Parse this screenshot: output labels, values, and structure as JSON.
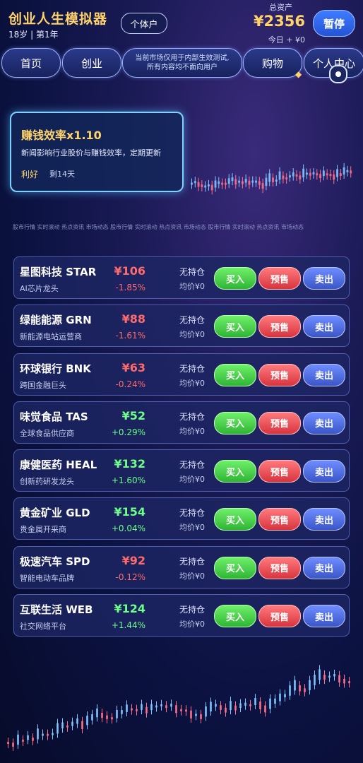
{
  "header": {
    "title": "创业人生模拟器",
    "info": "18岁 | 第1年",
    "role_button": "个体户",
    "assets_label": "总资产",
    "assets_value": "¥2356",
    "today_change": "今日 + ¥0",
    "pause_button": "暂停"
  },
  "nav": {
    "tabs": [
      "首页",
      "创业"
    ],
    "notice_line1": "当前市场仅用于内部生效测试,",
    "notice_line2": "所有内容均不面向用户",
    "tab_shop": "购物",
    "tab_profile": "个人中心"
  },
  "event": {
    "title": "赚钱效率x1.10",
    "description": "新闻影响行业股价与赚钱效率，定期更新",
    "tag": "利好",
    "remaining": "剩14天"
  },
  "ticker_text": "股市行情 实时滚动 热点资讯 市场动态 股市行情 实时滚动 热点资讯 市场动态 股市行情 实时滚动 热点资讯 市场动态",
  "buttons": {
    "buy": "买入",
    "presale": "预售",
    "sell": "卖出"
  },
  "stocks": [
    {
      "name": "星图科技 STAR",
      "desc": "AI芯片龙头",
      "price": "¥106",
      "change": "-1.85%",
      "trend": "down",
      "holding": "无持仓",
      "avg": "均价¥0"
    },
    {
      "name": "绿能能源 GRN",
      "desc": "新能源电站运营商",
      "price": "¥88",
      "change": "-1.61%",
      "trend": "down",
      "holding": "无持仓",
      "avg": "均价¥0"
    },
    {
      "name": "环球银行 BNK",
      "desc": "跨国金融巨头",
      "price": "¥63",
      "change": "-0.24%",
      "trend": "down",
      "holding": "无持仓",
      "avg": "均价¥0"
    },
    {
      "name": "味觉食品 TAS",
      "desc": "全球食品供应商",
      "price": "¥52",
      "change": "+0.29%",
      "trend": "up",
      "holding": "无持仓",
      "avg": "均价¥0"
    },
    {
      "name": "康健医药 HEAL",
      "desc": "创新药研发龙头",
      "price": "¥132",
      "change": "+1.60%",
      "trend": "up",
      "holding": "无持仓",
      "avg": "均价¥0"
    },
    {
      "name": "黄金矿业 GLD",
      "desc": "贵金属开采商",
      "price": "¥154",
      "change": "+0.04%",
      "trend": "up",
      "holding": "无持仓",
      "avg": "均价¥0"
    },
    {
      "name": "极速汽车 SPD",
      "desc": "智能电动车品牌",
      "price": "¥92",
      "change": "-0.12%",
      "trend": "down",
      "holding": "无持仓",
      "avg": "均价¥0"
    },
    {
      "name": "互联生活 WEB",
      "desc": "社交网络平台",
      "price": "¥124",
      "change": "+1.44%",
      "trend": "up",
      "holding": "无持仓",
      "avg": "均价¥0"
    }
  ],
  "colors": {
    "gold": "#ffd36a",
    "down": "#ff6b6b",
    "up": "#6dff8a",
    "accent": "#3f7cff"
  }
}
